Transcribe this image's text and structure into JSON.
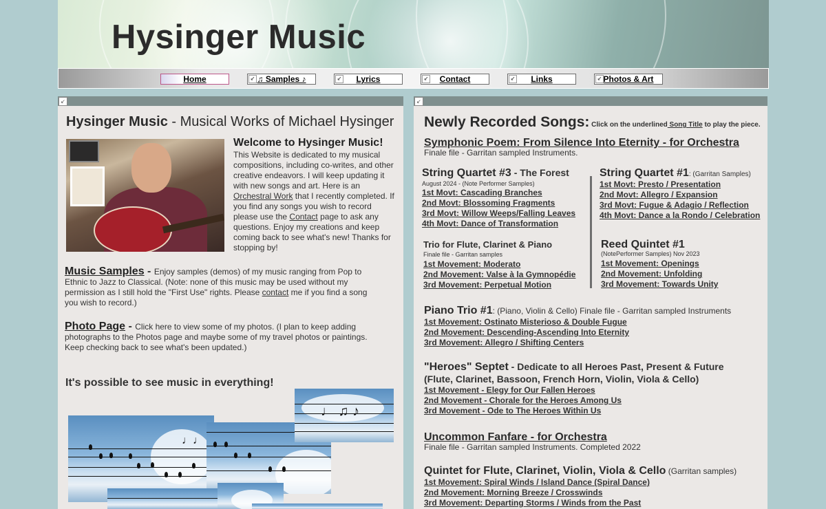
{
  "site": {
    "title": "Hysinger Music"
  },
  "nav": {
    "items": [
      {
        "label": "Home"
      },
      {
        "label": "♫ Samples ♪"
      },
      {
        "label": "Lyrics"
      },
      {
        "label": "Contact"
      },
      {
        "label": "Links"
      },
      {
        "label": "Photos & Art"
      }
    ]
  },
  "left": {
    "heading_bold": "Hysinger Music",
    "heading_rest": " - Musical Works of Michael Hysinger",
    "welcome_title": "Welcome to Hysinger Music!",
    "welcome_p1": "This Website is dedicated to my musical compositions, including co-writes, and other  creative endeavors. I will keep updating it with new songs and art. Here is an ",
    "welcome_link1": "Orchestral Work",
    "welcome_p2": " that I recently completed. If you find any songs you wish to record please use the ",
    "welcome_link2": "Contact",
    "welcome_p3": " page to ask any questions. Enjoy my creations and keep coming back to see what's new! Thanks for stopping by!",
    "samples_title": "Music Samples",
    "samples_dash": " - ",
    "samples_p1": "Enjoy samples (demos) of my music ranging from Pop to Ethnic to Jazz to Classical. (Note: none of this music may be used without my permission as I still hold the \"First Use\" rights. Please ",
    "samples_link": "contact",
    "samples_p2": " me if you find a song you wish to record.)",
    "photo_title": "Photo Page",
    "photo_dash": " - ",
    "photo_text": "Click here to view some of my photos. (I plan to keep adding photographs to the Photos page and maybe some of my travel photos or paintings. Keep checking back to see what's been updated.)",
    "music_everything": "It's possible to see music in everything!"
  },
  "right": {
    "heading": "Newly Recorded Songs:",
    "instr_1": " Click on the underlined",
    "instr_link": " Song Title",
    "instr_2": " to play the piece.",
    "symphonic": {
      "title": "Symphonic Poem: From Silence Into Eternity - for Orchestra",
      "note": "Finale file - Garritan sampled Instruments."
    },
    "sq3": {
      "title": "String Quartet #3",
      "subtitle": " - The Forest",
      "note": "August 2024 - (Note Performer Samples)",
      "movements": [
        "1st Movt:  Cascading Branches",
        "2nd Movt: Blossoming Fragments",
        "3rd Movt: Willow Weeps/Falling Leaves",
        "4th Movt: Dance of Transformation"
      ]
    },
    "sq1": {
      "title": "String Quartet #1",
      "note": ": (Garritan Samples)",
      "movements": [
        "1st Movt:  Presto / Presentation",
        "2nd Movt: Allegro / Expansion",
        "3rd Movt:  Fugue & Adagio / Reflection",
        "4th Movt: Dance a la Rondo / Celebration"
      ]
    },
    "trio": {
      "title": "Trio for Flute, Clarinet & Piano",
      "note": "Finale file - Garritan samples",
      "movements": [
        "1st Movement:  Moderato",
        "2nd Movement: Valse à la Gymnopédie",
        "3rd Movement: Perpetual Motion"
      ]
    },
    "reed": {
      "title": "Reed Quintet #1",
      "note": "(NotePerformer Samples) Nov 2023",
      "movements": [
        "1st Movement:   Openings",
        "2nd Movement:  Unfolding",
        "3rd Movement:   Towards Unity"
      ]
    },
    "piano_trio": {
      "title": "Piano Trio #1",
      "note": ": (Piano, Violin & Cello) Finale file - Garritan sampled Instruments",
      "movements": [
        "1st Movement:   Ostinato Misterioso & Double Fugue",
        "2nd Movement:  Descending-Ascending Into Eternity",
        "3rd Movement:  Allegro / Shifting Centers"
      ]
    },
    "heroes": {
      "title": "\"Heroes\" Septet",
      "subtitle": " - Dedicate to all Heroes Past, Present & Future",
      "instruments": "(Flute, Clarinet, Bassoon, French Horn, Violin, Viola & Cello)",
      "movements": [
        "1st Movement - Elegy for Our Fallen Heroes",
        "2nd Movement - Chorale for the Heroes Among Us",
        "3rd Movement - Ode to The Heroes Within Us"
      ]
    },
    "fanfare": {
      "title": "Uncommon Fanfare - for Orchestra",
      "note": "Finale file - Garritan sampled Instruments. Completed 2022"
    },
    "quintet": {
      "title": "Quintet for Flute, Clarinet, Violin, Viola & Cello",
      "note": " (Garritan samples)",
      "movements": [
        "1st Movement:   Spiral Winds / Island Dance (Spiral Dance)",
        "2nd Movement:   Morning Breeze / Crosswinds",
        "3rd Movement:    Departing Storms / Winds from the Past"
      ]
    }
  },
  "colors": {
    "background": "#b0cccf",
    "panel": "#ebe8e6",
    "panel_header": "#7f8f8e"
  },
  "icons": {
    "nav_button_icon": "link-arrow-icon",
    "column_header_icon": "link-arrow-icon"
  }
}
